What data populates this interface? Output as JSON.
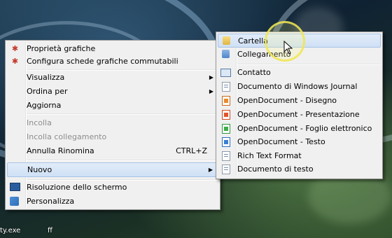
{
  "main_menu": {
    "items": [
      {
        "label": "Proprietà grafiche",
        "icon": "graphics-properties-icon"
      },
      {
        "label": "Configura schede grafiche commutabili",
        "icon": "switchable-graphics-icon"
      },
      {
        "label": "Visualizza",
        "submenu": true
      },
      {
        "label": "Ordina per",
        "submenu": true
      },
      {
        "label": "Aggiorna"
      },
      {
        "label": "Incolla",
        "disabled": true
      },
      {
        "label": "Incolla collegamento",
        "disabled": true
      },
      {
        "label": "Annulla Rinomina",
        "shortcut": "CTRL+Z"
      },
      {
        "label": "Nuovo",
        "submenu": true,
        "highlighted": true
      },
      {
        "label": "Risoluzione dello schermo",
        "icon": "monitor-icon"
      },
      {
        "label": "Personalizza",
        "icon": "personalize-icon"
      }
    ]
  },
  "new_submenu": {
    "items": [
      {
        "label": "Cartella",
        "icon": "folder-icon",
        "highlighted": true
      },
      {
        "label": "Collegamento",
        "icon": "shortcut-icon"
      },
      {
        "label": "Contatto",
        "icon": "contact-icon"
      },
      {
        "label": "Documento di Windows Journal",
        "icon": "journal-icon"
      },
      {
        "label": "OpenDocument - Disegno",
        "icon": "odg-icon"
      },
      {
        "label": "OpenDocument - Presentazione",
        "icon": "odp-icon"
      },
      {
        "label": "OpenDocument - Foglio elettronico",
        "icon": "ods-icon"
      },
      {
        "label": "OpenDocument - Testo",
        "icon": "odt-icon"
      },
      {
        "label": "Rich Text Format",
        "icon": "rtf-icon"
      },
      {
        "label": "Documento di testo",
        "icon": "text-document-icon"
      }
    ]
  },
  "desktop": {
    "icon_labels": [
      "ty.exe",
      "ff"
    ]
  },
  "colors": {
    "menu_bg": "#f0f0f0",
    "highlight": "#cfe0f6",
    "disabled_text": "#8d8d8d",
    "cursor_halo": "#f0e650"
  },
  "arrow_glyph": "▶"
}
